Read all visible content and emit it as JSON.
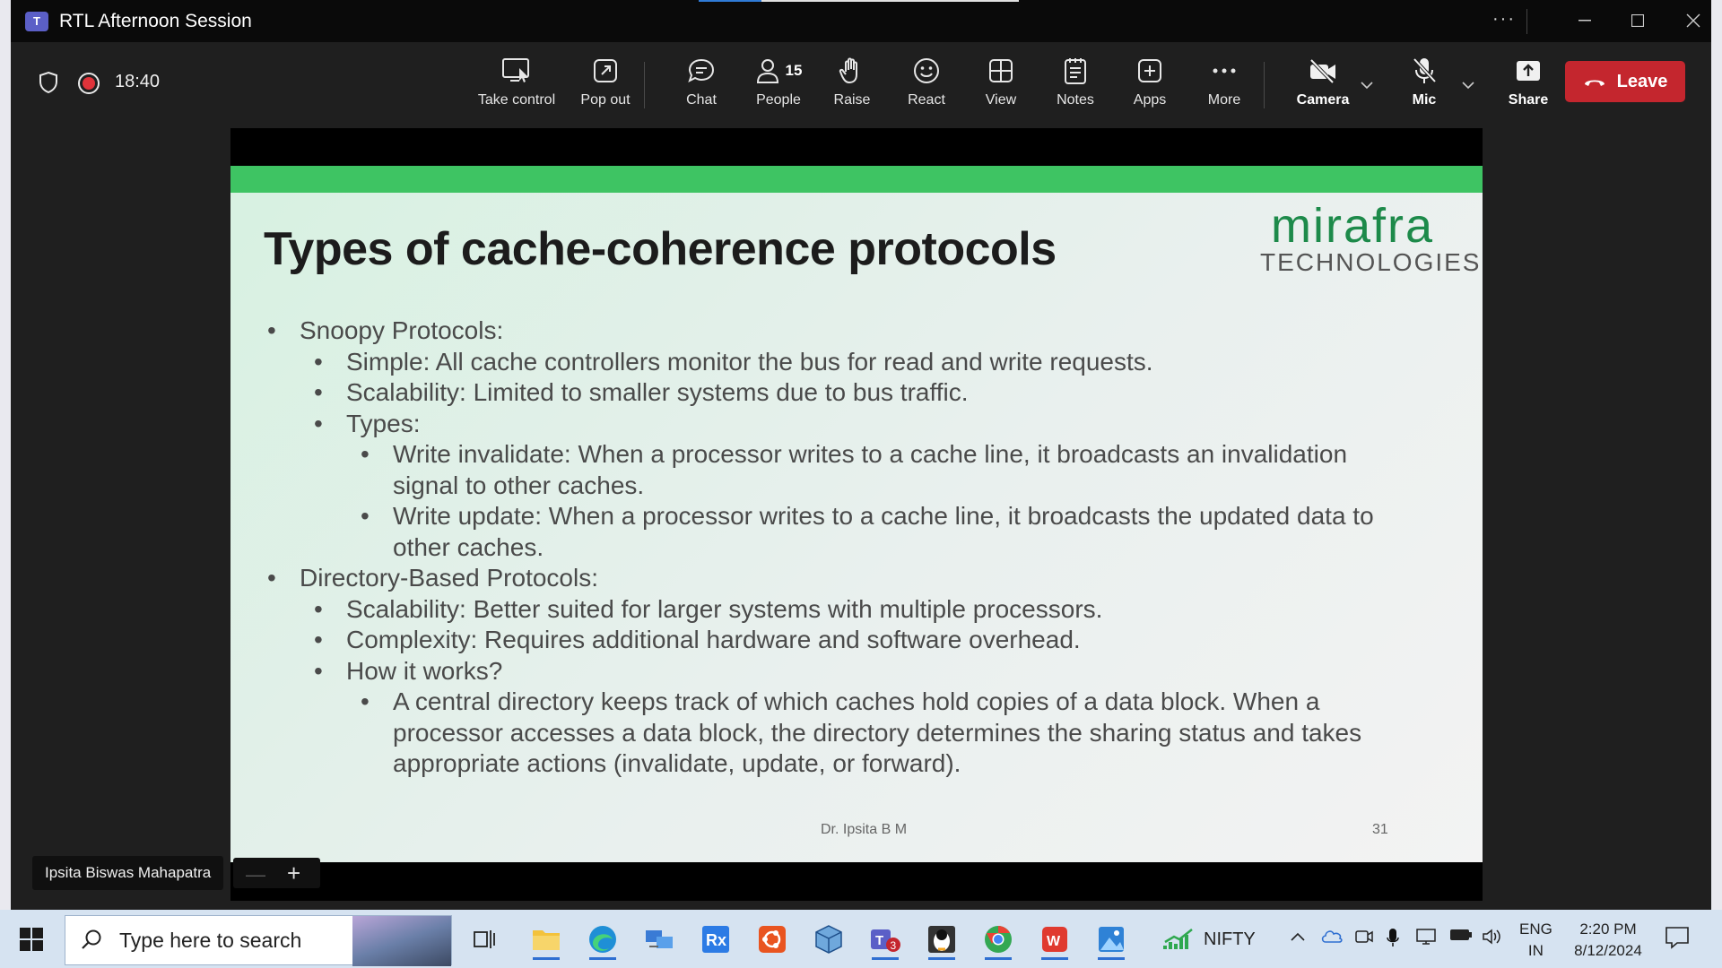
{
  "window": {
    "title": "RTL Afternoon Session"
  },
  "meeting": {
    "timer": "18:40",
    "toolbar": {
      "take_control": "Take control",
      "pop_out": "Pop out",
      "chat": "Chat",
      "people": "People",
      "people_count": "15",
      "raise": "Raise",
      "react": "React",
      "view": "View",
      "notes": "Notes",
      "apps": "Apps",
      "more": "More",
      "camera": "Camera",
      "mic": "Mic",
      "share": "Share",
      "leave": "Leave"
    },
    "presenter_name": "Ipsita Biswas Mahapatra"
  },
  "slide": {
    "title": "Types of cache-coherence protocols",
    "logo_main": "mirafra",
    "logo_sub": "TECHNOLOGIES",
    "lines": [
      "Snoopy Protocols:",
      "Simple: All cache controllers monitor the bus for read and write requests.",
      "Scalability: Limited to smaller systems due to bus traffic.",
      "Types:",
      "Write invalidate: When a processor writes to a cache line, it broadcasts an invalidation",
      "signal to other caches.",
      "Write update: When a processor writes to a cache line, it broadcasts the updated data to",
      "other caches.",
      "Directory-Based Protocols:",
      "Scalability: Better suited for larger systems with multiple processors.",
      "Complexity: Requires additional hardware and software overhead.",
      "How it works?",
      "A central directory keeps track of which caches hold copies of a data block. When a",
      "processor accesses a data block, the directory determines the sharing status and takes",
      "appropriate actions (invalidate, update, or forward)."
    ],
    "footer": "Dr. Ipsita B M",
    "page_number": "31"
  },
  "taskbar": {
    "search_placeholder": "Type here to search",
    "teams_badge": "3",
    "nifty_label": "NIFTY",
    "lang_line1": "ENG",
    "lang_line2": "IN",
    "time": "2:20 PM",
    "date": "8/12/2024"
  },
  "colors": {
    "leave_red": "#c4262e",
    "slide_band_green": "#3ec463",
    "logo_green": "#1d8a4a",
    "record_red": "#e0333a"
  }
}
